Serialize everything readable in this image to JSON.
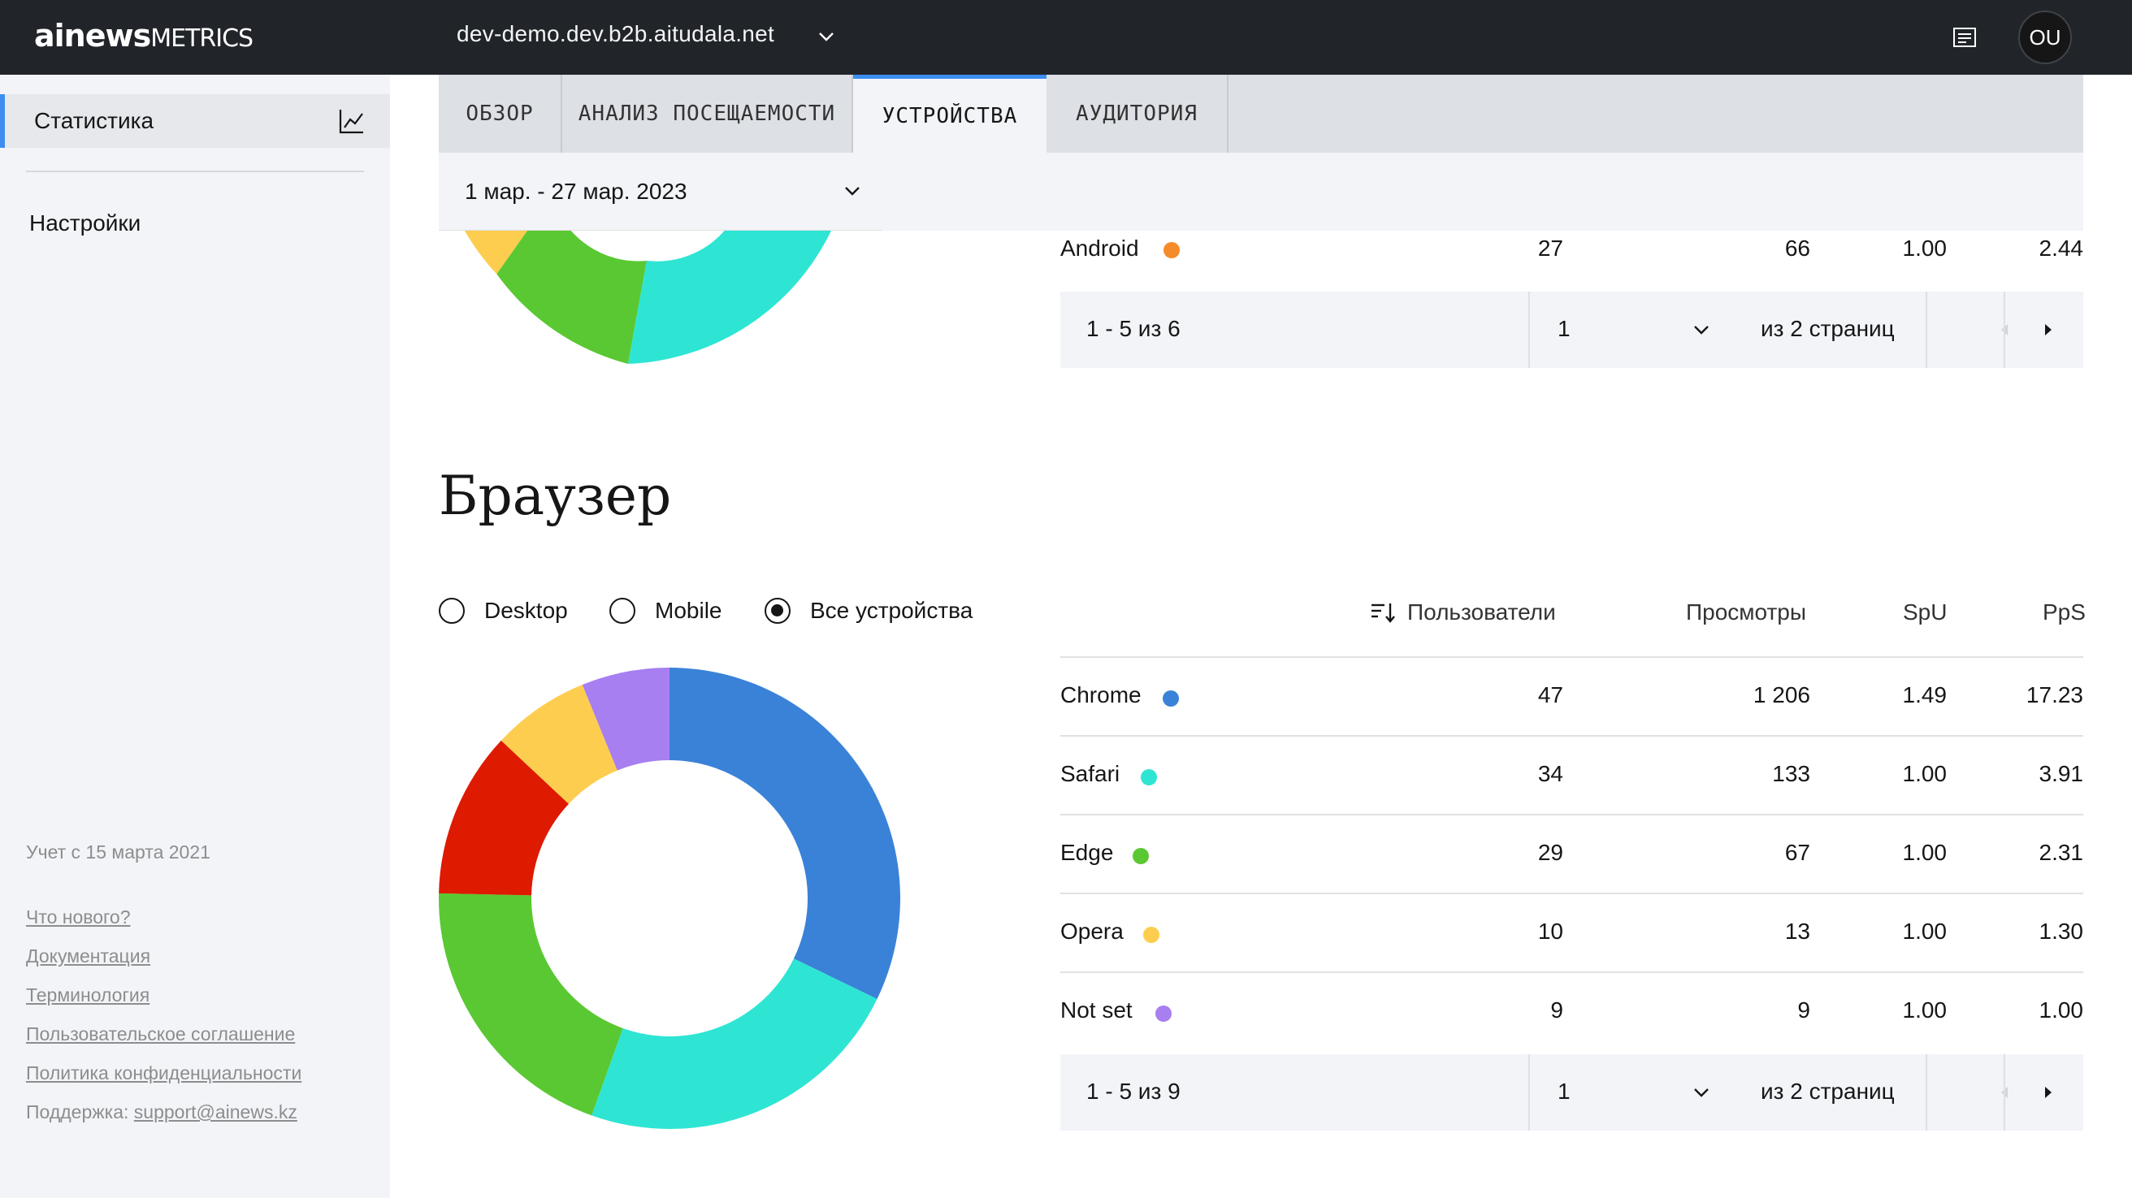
{
  "header": {
    "logo_bold": "ainews",
    "logo_thin": "METRICS",
    "domain": "dev-demo.dev.b2b.aitudala.net",
    "avatar_initials": "OU"
  },
  "sidebar": {
    "items": [
      {
        "label": "Статистика",
        "icon": "chart-icon",
        "active": true
      },
      {
        "label": "Настройки",
        "active": false
      }
    ],
    "since": "Учет с 15 марта 2021",
    "links": [
      "Что нового?",
      "Документация",
      "Терминология",
      "Пользовательское соглашение",
      "Политика конфиденциальности"
    ],
    "support_label": "Поддержка:",
    "support_email": "support@ainews.kz"
  },
  "tabs": [
    {
      "label": "ОБЗОР"
    },
    {
      "label": "АНАЛИЗ ПОСЕЩАЕМОСТИ"
    },
    {
      "label": "УСТРОЙСТВА",
      "active": true
    },
    {
      "label": "АУДИТОРИЯ"
    }
  ],
  "date_range": "1 мар. - 27 мар. 2023",
  "os_section": {
    "last_row": {
      "name": "Android",
      "color": "#f58b2a",
      "users": "27",
      "views": "66",
      "spu": "1.00",
      "pps": "2.44"
    },
    "pager": {
      "range": "1 - 5 из 6",
      "page": "1",
      "of": "из 2 страниц"
    },
    "donut_colors": [
      "#fdcd4f",
      "#5ac832",
      "#2ee5d3"
    ]
  },
  "browser_section": {
    "title": "Браузер",
    "filters": [
      {
        "label": "Desktop",
        "checked": false
      },
      {
        "label": "Mobile",
        "checked": false
      },
      {
        "label": "Все устройства",
        "checked": true
      }
    ],
    "columns": [
      "Пользователи",
      "Просмотры",
      "SpU",
      "PpS"
    ],
    "rows": [
      {
        "name": "Chrome",
        "color": "#3a82d8",
        "users": "47",
        "views": "1 206",
        "spu": "1.49",
        "pps": "17.23"
      },
      {
        "name": "Safari",
        "color": "#2ee5d3",
        "users": "34",
        "views": "133",
        "spu": "1.00",
        "pps": "3.91"
      },
      {
        "name": "Edge",
        "color": "#5ac832",
        "users": "29",
        "views": "67",
        "spu": "1.00",
        "pps": "2.31"
      },
      {
        "name": "Opera",
        "color": "#fdcd4f",
        "users": "10",
        "views": "13",
        "spu": "1.00",
        "pps": "1.30"
      },
      {
        "name": "Not set",
        "color": "#a77ff0",
        "users": "9",
        "views": "9",
        "spu": "1.00",
        "pps": "1.00"
      }
    ],
    "pager": {
      "range": "1 - 5 из 9",
      "page": "1",
      "of": "из 2 страниц"
    }
  },
  "chart_data": {
    "type": "pie",
    "categories": [
      "Chrome",
      "Safari",
      "Edge",
      "Red (unlabeled)",
      "Opera",
      "Not set"
    ],
    "values": [
      47,
      34,
      29,
      17,
      10,
      9
    ],
    "colors": [
      "#3a82d8",
      "#2ee5d3",
      "#5ac832",
      "#de1a00",
      "#fdcd4f",
      "#a77ff0"
    ],
    "title": "",
    "donut": true
  }
}
